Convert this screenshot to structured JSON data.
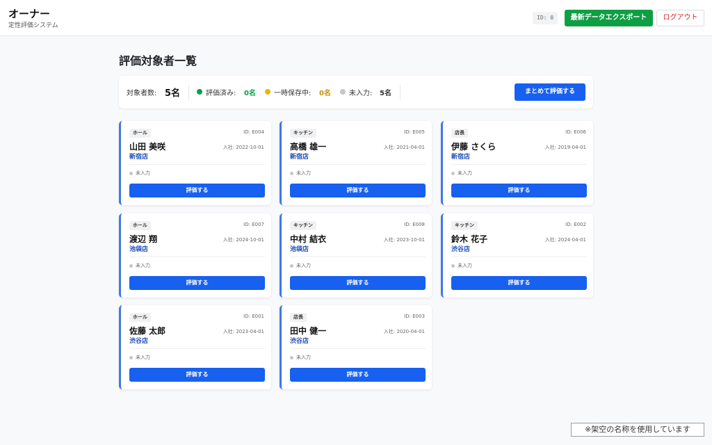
{
  "header": {
    "title": "オーナー",
    "subtitle": "定性評価システム",
    "id_chip": "ID: 0",
    "export_label": "最新データエクスポート",
    "logout_label": "ログアウト"
  },
  "page_title": "評価対象者一覧",
  "summary": {
    "total_label": "対象者数:",
    "total_value": "5名",
    "evaluated_label": "評価済み:",
    "evaluated_value": "0名",
    "saved_label": "一時保存中:",
    "saved_value": "0名",
    "pending_label": "未入力:",
    "pending_value": "5名",
    "bulk_label": "まとめて評価する"
  },
  "cards": [
    {
      "role": "ホール",
      "id": "ID: E004",
      "name": "山田 美咲",
      "hire": "入社: 2022-10-01",
      "store": "新宿店",
      "status": "未入力",
      "button": "評価する"
    },
    {
      "role": "キッチン",
      "id": "ID: E005",
      "name": "高橋 雄一",
      "hire": "入社: 2021-04-01",
      "store": "新宿店",
      "status": "未入力",
      "button": "評価する"
    },
    {
      "role": "店長",
      "id": "ID: E006",
      "name": "伊藤 さくら",
      "hire": "入社: 2019-04-01",
      "store": "新宿店",
      "status": "未入力",
      "button": "評価する"
    },
    {
      "role": "ホール",
      "id": "ID: E007",
      "name": "渡辺 翔",
      "hire": "入社: 2024-10-01",
      "store": "池袋店",
      "status": "未入力",
      "button": "評価する"
    },
    {
      "role": "キッチン",
      "id": "ID: E008",
      "name": "中村 結衣",
      "hire": "入社: 2023-10-01",
      "store": "池袋店",
      "status": "未入力",
      "button": "評価する"
    },
    {
      "role": "キッチン",
      "id": "ID: E002",
      "name": "鈴木 花子",
      "hire": "入社: 2024-04-01",
      "store": "渋谷店",
      "status": "未入力",
      "button": "評価する"
    },
    {
      "role": "ホール",
      "id": "ID: E001",
      "name": "佐藤 太郎",
      "hire": "入社: 2023-04-01",
      "store": "渋谷店",
      "status": "未入力",
      "button": "評価する"
    },
    {
      "role": "店長",
      "id": "ID: E003",
      "name": "田中 健一",
      "hire": "入社: 2020-04-01",
      "store": "渋谷店",
      "status": "未入力",
      "button": "評価する"
    }
  ],
  "footer_note": "※架空の名称を使用しています",
  "colors": {
    "accent": "#1760f0",
    "export": "#0e9f45",
    "evaluated": "#0e9f45",
    "saved": "#e6a800",
    "pending": "#c3c6cb",
    "logout": "#dd2222"
  }
}
